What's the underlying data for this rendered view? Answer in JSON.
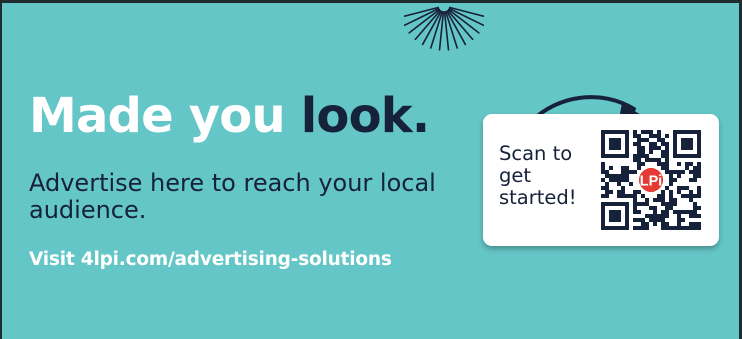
{
  "ad": {
    "headline_part1": "Made you ",
    "headline_part2": "look.",
    "subline": "Advertise here to reach your local audience.",
    "link": "Visit 4lpi.com/advertising-solutions",
    "card": {
      "scan_text": "Scan to get started!",
      "qr_badge_text": "LPi"
    }
  },
  "colors": {
    "background": "#65c6c7",
    "headline_white": "#ffffff",
    "dark_navy": "#16213a",
    "badge_red": "#e53b35",
    "card": "#ffffff"
  },
  "icons": {
    "sunburst": "sunburst-decoration-icon",
    "arrow": "curved-arrow-icon",
    "qr": "qr-code-icon"
  }
}
